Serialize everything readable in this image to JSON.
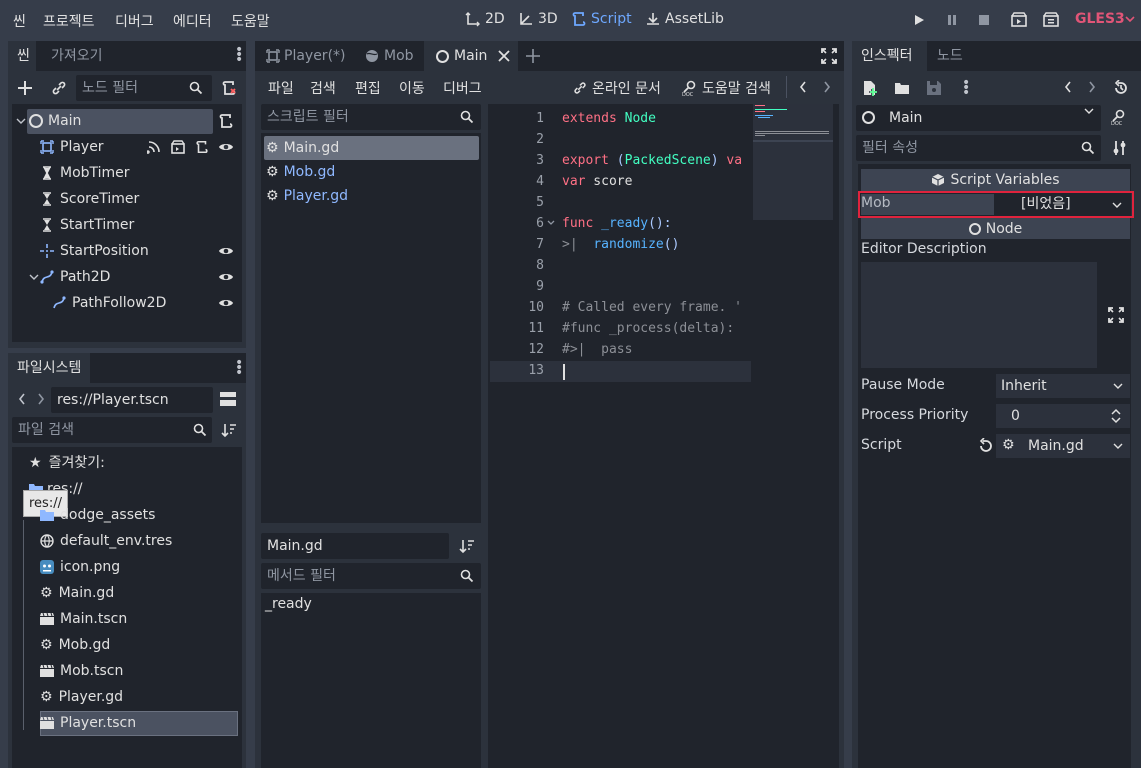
{
  "menu": {
    "items": [
      "씬",
      "프로젝트",
      "디버그",
      "에디터",
      "도움말"
    ],
    "workspaces": [
      {
        "label": "2D",
        "icon": "2d-icon",
        "active": false
      },
      {
        "label": "3D",
        "icon": "3d-icon",
        "active": false
      },
      {
        "label": "Script",
        "icon": "script-icon",
        "active": true
      },
      {
        "label": "AssetLib",
        "icon": "assetlib-icon",
        "active": false
      }
    ],
    "renderer": "GLES3",
    "colors": {
      "active": "#6ea8ff",
      "renderer": "#e15577"
    }
  },
  "scene_dock": {
    "tabs": [
      "씬",
      "가져오기"
    ],
    "filter_placeholder": "노드 필터",
    "nodes": [
      {
        "label": "Main",
        "icon": "node-icon",
        "depth": 0,
        "selected": true
      },
      {
        "label": "Player",
        "icon": "area2d-icon",
        "depth": 1
      },
      {
        "label": "MobTimer",
        "icon": "timer-icon",
        "depth": 1
      },
      {
        "label": "ScoreTimer",
        "icon": "timer-icon",
        "depth": 1
      },
      {
        "label": "StartTimer",
        "icon": "timer-icon",
        "depth": 1
      },
      {
        "label": "StartPosition",
        "icon": "position2d-icon",
        "depth": 1
      },
      {
        "label": "Path2D",
        "icon": "path2d-icon",
        "depth": 1
      },
      {
        "label": "PathFollow2D",
        "icon": "pathfollow2d-icon",
        "depth": 2
      }
    ]
  },
  "filesystem": {
    "title": "파일시스템",
    "path": "res://Player.tscn",
    "search_placeholder": "파일 검색",
    "favorites_label": "즐겨찾기:",
    "root": "res://",
    "tooltip": "res://",
    "files": [
      {
        "label": "dodge_assets",
        "icon": "folder-icon"
      },
      {
        "label": "default_env.tres",
        "icon": "environment-icon"
      },
      {
        "label": "icon.png",
        "icon": "image-icon"
      },
      {
        "label": "Main.gd",
        "icon": "gear-icon"
      },
      {
        "label": "Main.tscn",
        "icon": "scene-icon"
      },
      {
        "label": "Mob.gd",
        "icon": "gear-icon"
      },
      {
        "label": "Mob.tscn",
        "icon": "scene-icon"
      },
      {
        "label": "Player.gd",
        "icon": "gear-icon"
      },
      {
        "label": "Player.tscn",
        "icon": "scene-icon",
        "selected": true
      }
    ]
  },
  "scene_tabs": {
    "tabs": [
      {
        "label": "Player(*)",
        "icon": "area2d-icon",
        "active": false
      },
      {
        "label": "Mob",
        "icon": "rigidbody-icon",
        "active": false
      },
      {
        "label": "Main",
        "icon": "node-icon",
        "active": true
      }
    ]
  },
  "script_editor": {
    "menu": [
      "파일",
      "검색",
      "편집",
      "이동",
      "디버그"
    ],
    "online_docs": "온라인 문서",
    "help_search": "도움말 검색",
    "script_filter_placeholder": "스크립트 필터",
    "scripts": [
      {
        "label": "Main.gd",
        "selected": true
      },
      {
        "label": "Mob.gd"
      },
      {
        "label": "Player.gd"
      }
    ],
    "current_script": "Main.gd",
    "method_filter_placeholder": "메서드 필터",
    "methods": [
      "_ready"
    ],
    "line_numbers": [
      "1",
      "2",
      "3",
      "4",
      "5",
      "6",
      "7",
      "8",
      "9",
      "10",
      "11",
      "12",
      "13"
    ]
  },
  "inspector": {
    "tabs": [
      "인스펙터",
      "노드"
    ],
    "object_name": "Main",
    "filter_placeholder": "필터 속성",
    "section_script_vars": "Script Variables",
    "mob_label": "Mob",
    "mob_value": "[비었음]",
    "section_node": "Node",
    "editor_description": "Editor Description",
    "pause_mode_label": "Pause Mode",
    "pause_mode_value": "Inherit",
    "process_priority_label": "Process Priority",
    "process_priority_value": "0",
    "script_label": "Script",
    "script_value": "Main.gd",
    "highlight_color": "#e0233d"
  }
}
